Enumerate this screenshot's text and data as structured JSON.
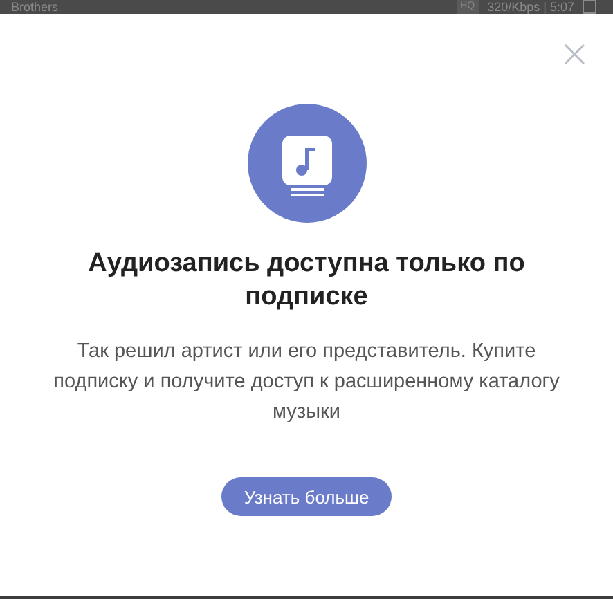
{
  "background_bar": {
    "track": "Brothers",
    "quality": "HQ",
    "bitrate": "320/Kbps | 5:07"
  },
  "dialog": {
    "close": "×",
    "title": "Аудиозапись доступна только по подписке",
    "message": "Так решил артист или его представитель. Купите подписку и получите доступ к расширенному каталогу музыки",
    "button": "Узнать больше"
  }
}
